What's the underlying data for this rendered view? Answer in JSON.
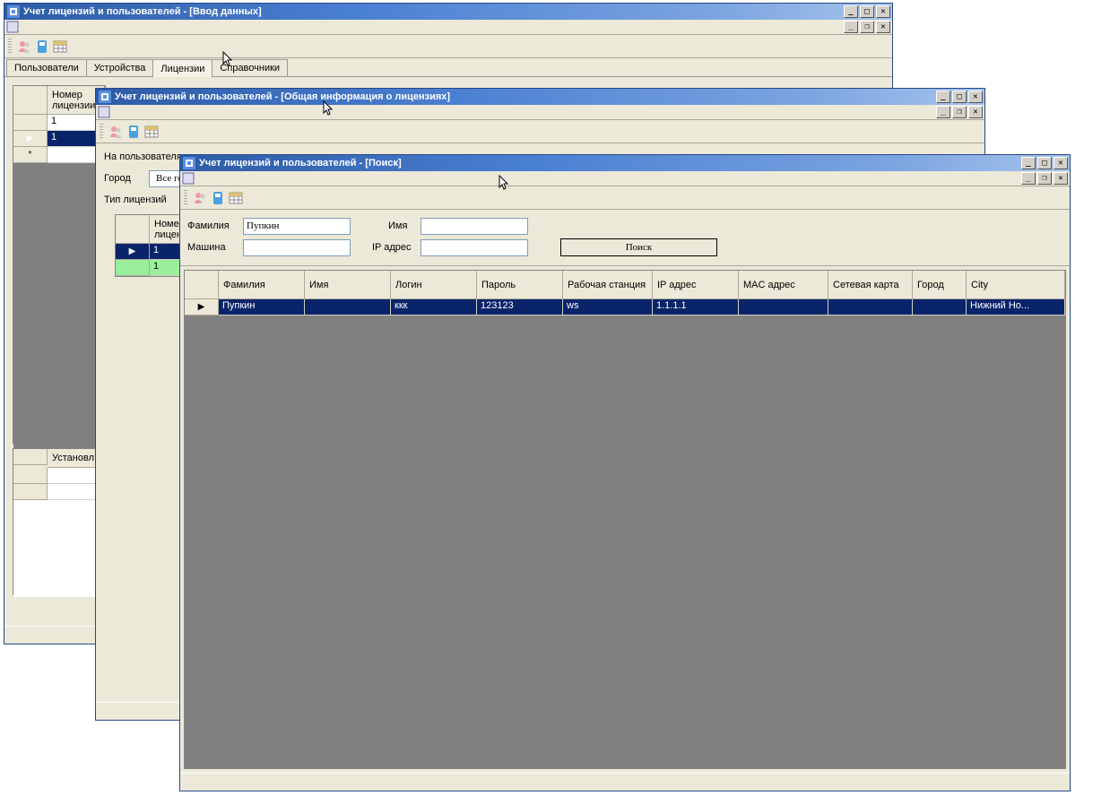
{
  "win1": {
    "title": "Учет лицензий и пользователей - [Ввод данных]",
    "tabs": [
      "Пользователи",
      "Устройства",
      "Лицензии",
      "Справочники"
    ],
    "activeTab": 2,
    "gridTop": {
      "headers": [
        "Номер лицензии"
      ],
      "rows": [
        {
          "marker": "",
          "cells": [
            "1"
          ]
        },
        {
          "marker": "▶",
          "cells": [
            "1"
          ],
          "selected": true
        },
        {
          "marker": "*",
          "cells": [
            ""
          ]
        }
      ]
    },
    "gridBottom": {
      "headers": [
        "Установл."
      ]
    }
  },
  "win2": {
    "title": "Учет лицензий и пользователей - [Общая информация о лицензиях]",
    "labels": {
      "naUser": "На пользователя",
      "gorod": "Город",
      "tipLic": "Тип лицензий"
    },
    "cityValue": "Все города",
    "grid": {
      "headers": [
        "Номер лицензии"
      ],
      "rows": [
        {
          "marker": "▶",
          "cells": [
            "1"
          ],
          "bg": "selected"
        },
        {
          "marker": "",
          "cells": [
            "1"
          ],
          "bg": "green"
        }
      ]
    }
  },
  "win3": {
    "title": "Учет лицензий и пользователей - [Поиск]",
    "searchForm": {
      "labels": {
        "famil": "Фамилия",
        "imya": "Имя",
        "mashina": "Машина",
        "ip": "IP адрес"
      },
      "values": {
        "famil": "Пупкин",
        "imya": "",
        "mashina": "",
        "ip": ""
      },
      "button": "Поиск"
    },
    "results": {
      "headers": [
        "Фамилия",
        "Имя",
        "Логин",
        "Пароль",
        "Рабочая станция",
        "IP адрес",
        "MAC адрес",
        "Сетевая карта",
        "Город",
        "City"
      ],
      "rows": [
        {
          "marker": "▶",
          "cells": [
            "Пупкин",
            "",
            "ккк",
            "123123",
            "ws",
            "1.1.1.1",
            "",
            "",
            "",
            "Нижний Но..."
          ]
        }
      ]
    }
  },
  "icons": {
    "user": "👥",
    "key": "🔑",
    "table": "▦"
  }
}
